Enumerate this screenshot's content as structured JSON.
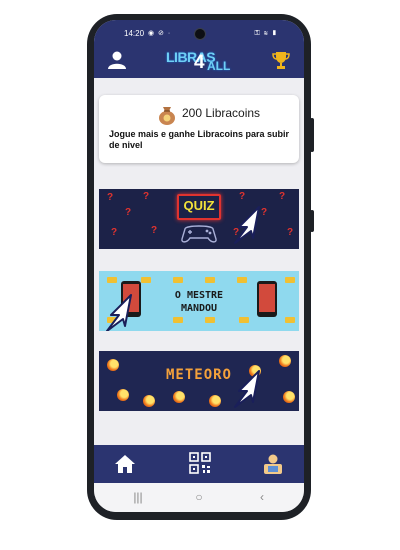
{
  "status_bar": {
    "time": "14:20",
    "left_icons": "◉ ⊘ ·",
    "right_icons": "⚿ ≋ ▮"
  },
  "header": {
    "logo_main": "LIBRAS",
    "logo_number": "4",
    "logo_suffix": "ALL",
    "user_icon": "user-icon",
    "trophy_icon": "trophy-icon"
  },
  "coin_card": {
    "title": "200 Libracoins",
    "description": "Jogue mais e ganhe Libracoins para subir de nivel",
    "icon": "coin-bag-icon"
  },
  "games": [
    {
      "name": "quiz",
      "label": "QUIZ"
    },
    {
      "name": "mestre",
      "label_line1": "O MESTRE",
      "label_line2": "MANDOU"
    },
    {
      "name": "meteoro",
      "label": "METEORO"
    }
  ],
  "bottom_nav": {
    "items": [
      "home-icon",
      "qr-code-icon",
      "profile-icon"
    ]
  },
  "system_nav": {
    "recents": "|||",
    "home": "○",
    "back": "‹"
  },
  "colors": {
    "header": "#2b3470",
    "background": "#eeeef2",
    "accent_red": "#e0332f",
    "accent_yellow": "#f2e23a"
  }
}
